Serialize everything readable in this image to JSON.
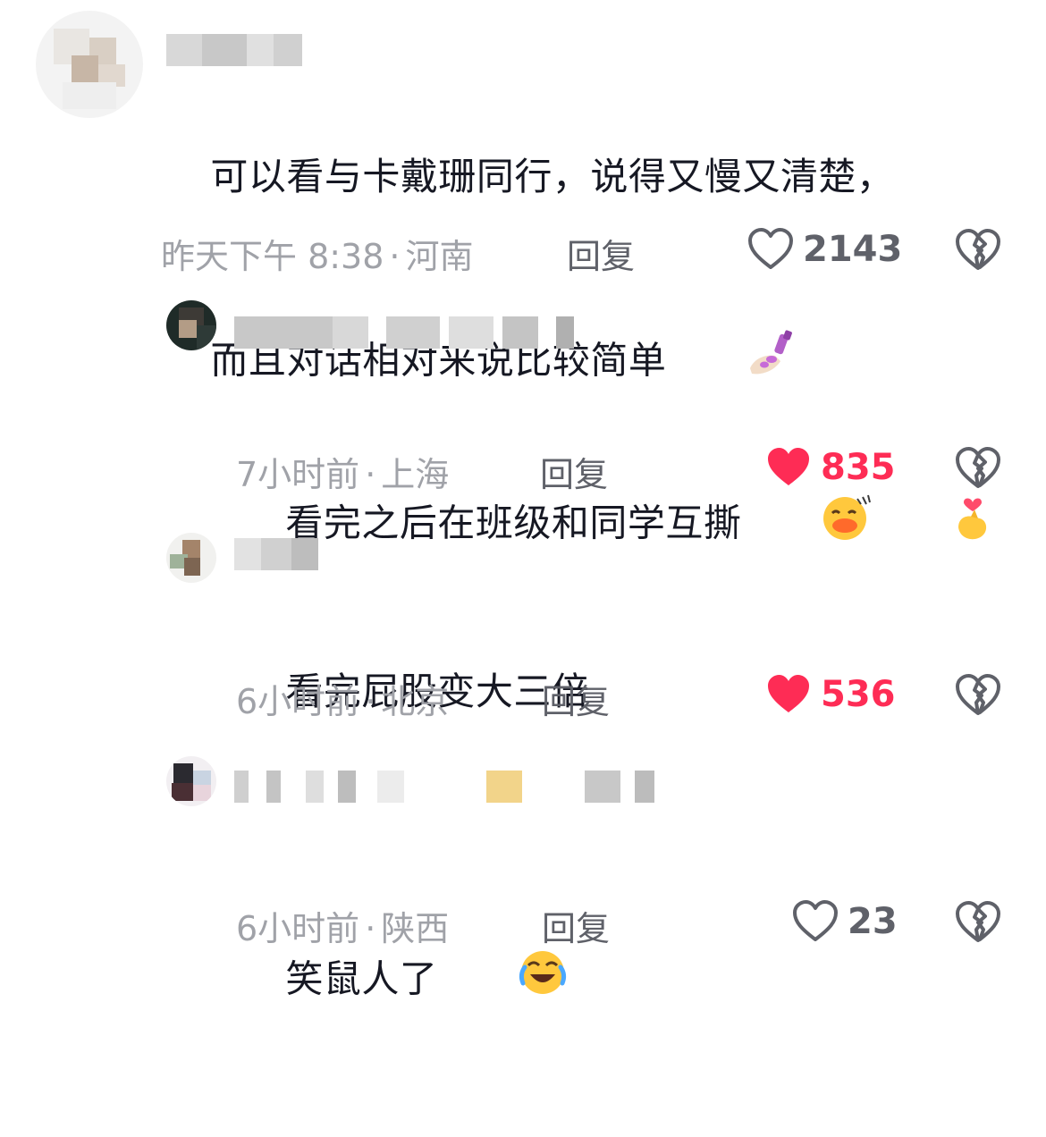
{
  "comments": [
    {
      "text_lines": [
        "可以看与卡戴珊同行，说得又慢又清楚，",
        "而且对话相对来说比较简单"
      ],
      "emoji_names": [
        "nail-polish-emoji"
      ],
      "time": "昨天下午 8:38",
      "location": "河南",
      "reply_label": "回复",
      "likes": "2143",
      "liked": false
    },
    {
      "text_lines": [
        "看完之后在班级和同学互撕"
      ],
      "emoji_names": [
        "kiss-face-emoji",
        "finger-heart-emoji"
      ],
      "time": "7小时前",
      "location": "上海",
      "reply_label": "回复",
      "likes": "835",
      "liked": true
    },
    {
      "text_lines": [
        "看完屁股变大三倍"
      ],
      "emoji_names": [],
      "time": "6小时前",
      "location": "北京",
      "reply_label": "回复",
      "likes": "536",
      "liked": true
    },
    {
      "text_lines": [
        "笑鼠人了"
      ],
      "emoji_names": [
        "tears-of-joy-emoji"
      ],
      "time": "6小时前",
      "location": "陕西",
      "reply_label": "回复",
      "likes": "23",
      "liked": false
    }
  ],
  "meta_separator": "·",
  "colors": {
    "text": "#161823",
    "meta": "#a0a2a8",
    "reply": "#5f6169",
    "like_active": "#fe2c55",
    "like_inactive": "#5f6169"
  }
}
